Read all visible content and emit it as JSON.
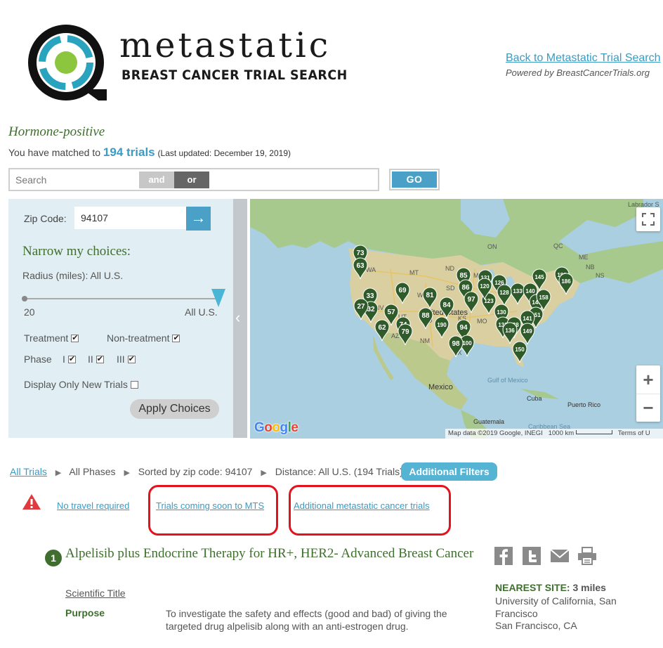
{
  "header": {
    "brand_name": "metastatic",
    "brand_sub": "BREAST CANCER TRIAL SEARCH",
    "back_link": "Back to Metastatic Trial Search",
    "powered_by": "Powered by BreastCancerTrials.org"
  },
  "summary": {
    "hormone_label": "Hormone-positive",
    "match_prefix": "You have matched to",
    "match_count": "194 trials",
    "last_updated": "(Last updated: December 19, 2019)"
  },
  "search": {
    "placeholder": "Search",
    "and_label": "and",
    "or_label": "or",
    "go_label": "GO"
  },
  "filters": {
    "zip_label": "Zip Code:",
    "zip_value": "94107",
    "zip_go_icon": "arrow-right-icon",
    "narrow_title": "Narrow my choices:",
    "radius_label": "Radius (miles): All U.S.",
    "slider_min": "20",
    "slider_max": "All U.S.",
    "slider_position_fraction": 1.0,
    "treatment_label": "Treatment",
    "treatment_checked": true,
    "non_treatment_label": "Non-treatment",
    "non_treatment_checked": true,
    "phase_label": "Phase",
    "phase_1_label": "I",
    "phase_2_label": "II",
    "phase_3_label": "III",
    "phases_checked": true,
    "new_trials_label": "Display Only New Trials",
    "new_trials_checked": false,
    "apply_label": "Apply Choices"
  },
  "map": {
    "labels": {
      "labrador": "Labrador S",
      "qc": "QC",
      "on": "ON",
      "mt": "MT",
      "nd": "ND",
      "mn": "MN",
      "wa": "WA",
      "sd": "SD",
      "wy": "WY",
      "ut": "UT",
      "co": "CO",
      "nv": "NV",
      "ks": "KS",
      "mo": "MO",
      "az": "AZ",
      "nm": "NM",
      "ok": "OK",
      "tx": "TX",
      "me": "ME",
      "nb": "NB",
      "ns": "NS",
      "united_states": "United States",
      "gulf": "Gulf of Mexico",
      "mexico": "Mexico",
      "cuba": "Cuba",
      "puerto_rico": "Puerto Rico",
      "guatemala": "Guatemala",
      "caribbean": "Caribbean Sea"
    },
    "markers": [
      {
        "label": "73"
      },
      {
        "label": "63"
      },
      {
        "label": "69"
      },
      {
        "label": "81"
      },
      {
        "label": "85"
      },
      {
        "label": "86"
      },
      {
        "label": "97"
      },
      {
        "label": "84"
      },
      {
        "label": "123"
      },
      {
        "label": "121"
      },
      {
        "label": "126"
      },
      {
        "label": "120"
      },
      {
        "label": "133"
      },
      {
        "label": "128"
      },
      {
        "label": "140"
      },
      {
        "label": "145"
      },
      {
        "label": "183"
      },
      {
        "label": "186"
      },
      {
        "label": "146"
      },
      {
        "label": "158"
      },
      {
        "label": "151"
      },
      {
        "label": "141"
      },
      {
        "label": "130"
      },
      {
        "label": "132"
      },
      {
        "label": "138"
      },
      {
        "label": "136"
      },
      {
        "label": "149"
      },
      {
        "label": "150"
      },
      {
        "label": "190"
      },
      {
        "label": "94"
      },
      {
        "label": "100"
      },
      {
        "label": "98"
      },
      {
        "label": "88"
      },
      {
        "label": "57"
      },
      {
        "label": "33"
      },
      {
        "label": "32"
      },
      {
        "label": "27"
      },
      {
        "label": "62"
      },
      {
        "label": "74"
      },
      {
        "label": "79"
      }
    ],
    "google_logo": "Google",
    "attribution": "Map data ©2019 Google, INEGI",
    "scale": "1000 km",
    "terms": "Terms of U",
    "zoom_in": "+",
    "zoom_out": "−"
  },
  "breadcrumb": {
    "all_trials": "All Trials",
    "all_phases": "All Phases",
    "sorted_by": "Sorted by zip code: 94107",
    "distance": "Distance: All U.S. (194 Trials)",
    "additional_filters": "Additional Filters"
  },
  "alerts": {
    "no_travel": "No travel required",
    "coming_soon": "Trials coming soon to MTS",
    "additional_trials": "Additional metastatic cancer trials"
  },
  "trial": {
    "number": "1",
    "title": "Alpelisib plus Endocrine Therapy for HR+, HER2- Advanced Breast Cancer",
    "scientific_title_link": "Scientific Title",
    "purpose_label": "Purpose",
    "purpose_text": "To investigate the safety and effects (good and bad) of giving the targeted drug alpelisib along with an anti-estrogen drug.",
    "nearest_label": "NEAREST SITE:",
    "nearest_distance": "3 miles",
    "nearest_name": "University of California, San Francisco",
    "nearest_city": "San Francisco, CA",
    "share_icons": [
      "facebook-icon",
      "twitter-icon",
      "email-icon",
      "print-icon"
    ]
  },
  "colors": {
    "accent_blue": "#4aa0c6",
    "link_blue": "#3a9bc4",
    "green_heading": "#3f6e2f",
    "highlight_red": "#e3121d",
    "marker_green": "#2f5a2a"
  }
}
